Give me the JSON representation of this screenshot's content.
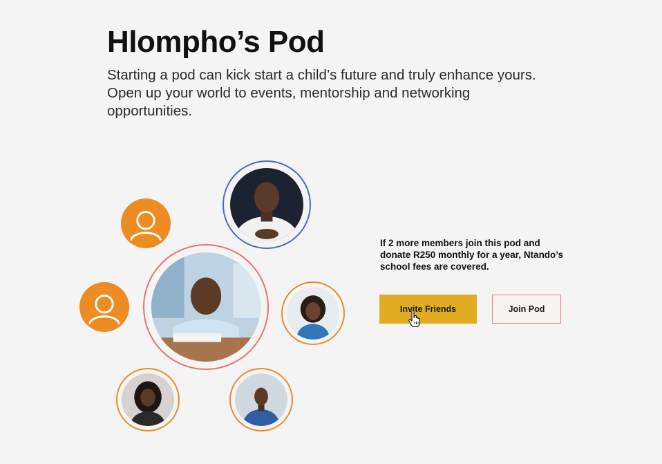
{
  "page": {
    "title": "Hlompho’s Pod",
    "intro": "Starting a pod can kick start a child’s future and truly enhance yours. Open up your world to events, mentorship and networking opportunities."
  },
  "pitch": {
    "text": "If 2 more members  join this pod and donate R250 monthly for a year, Ntando’s school fees are covered."
  },
  "actions": {
    "invite_label": "Invite Friends",
    "join_label": "Join Pod"
  },
  "colors": {
    "accent_orange": "#ec8c22",
    "accent_yellow": "#e2ac22",
    "ring_blue": "#4a68c6",
    "ring_coral": "#ee7070"
  },
  "icons": [
    "user-placeholder-icon",
    "hand-pointer-cursor-icon"
  ]
}
